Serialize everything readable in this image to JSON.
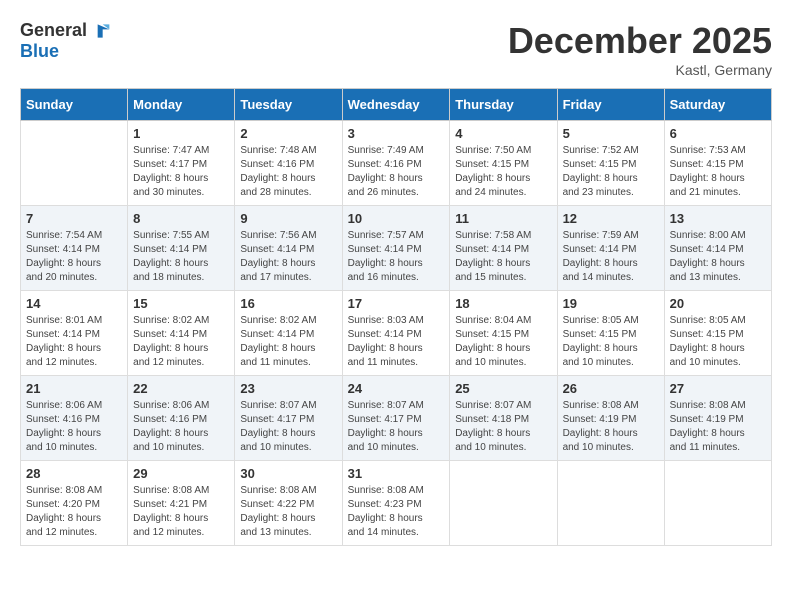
{
  "header": {
    "logo_general": "General",
    "logo_blue": "Blue",
    "month_year": "December 2025",
    "location": "Kastl, Germany"
  },
  "calendar": {
    "days_of_week": [
      "Sunday",
      "Monday",
      "Tuesday",
      "Wednesday",
      "Thursday",
      "Friday",
      "Saturday"
    ],
    "weeks": [
      [
        {
          "day": "",
          "sunrise": "",
          "sunset": "",
          "daylight": ""
        },
        {
          "day": "1",
          "sunrise": "Sunrise: 7:47 AM",
          "sunset": "Sunset: 4:17 PM",
          "daylight": "Daylight: 8 hours and 30 minutes."
        },
        {
          "day": "2",
          "sunrise": "Sunrise: 7:48 AM",
          "sunset": "Sunset: 4:16 PM",
          "daylight": "Daylight: 8 hours and 28 minutes."
        },
        {
          "day": "3",
          "sunrise": "Sunrise: 7:49 AM",
          "sunset": "Sunset: 4:16 PM",
          "daylight": "Daylight: 8 hours and 26 minutes."
        },
        {
          "day": "4",
          "sunrise": "Sunrise: 7:50 AM",
          "sunset": "Sunset: 4:15 PM",
          "daylight": "Daylight: 8 hours and 24 minutes."
        },
        {
          "day": "5",
          "sunrise": "Sunrise: 7:52 AM",
          "sunset": "Sunset: 4:15 PM",
          "daylight": "Daylight: 8 hours and 23 minutes."
        },
        {
          "day": "6",
          "sunrise": "Sunrise: 7:53 AM",
          "sunset": "Sunset: 4:15 PM",
          "daylight": "Daylight: 8 hours and 21 minutes."
        }
      ],
      [
        {
          "day": "7",
          "sunrise": "Sunrise: 7:54 AM",
          "sunset": "Sunset: 4:14 PM",
          "daylight": "Daylight: 8 hours and 20 minutes."
        },
        {
          "day": "8",
          "sunrise": "Sunrise: 7:55 AM",
          "sunset": "Sunset: 4:14 PM",
          "daylight": "Daylight: 8 hours and 18 minutes."
        },
        {
          "day": "9",
          "sunrise": "Sunrise: 7:56 AM",
          "sunset": "Sunset: 4:14 PM",
          "daylight": "Daylight: 8 hours and 17 minutes."
        },
        {
          "day": "10",
          "sunrise": "Sunrise: 7:57 AM",
          "sunset": "Sunset: 4:14 PM",
          "daylight": "Daylight: 8 hours and 16 minutes."
        },
        {
          "day": "11",
          "sunrise": "Sunrise: 7:58 AM",
          "sunset": "Sunset: 4:14 PM",
          "daylight": "Daylight: 8 hours and 15 minutes."
        },
        {
          "day": "12",
          "sunrise": "Sunrise: 7:59 AM",
          "sunset": "Sunset: 4:14 PM",
          "daylight": "Daylight: 8 hours and 14 minutes."
        },
        {
          "day": "13",
          "sunrise": "Sunrise: 8:00 AM",
          "sunset": "Sunset: 4:14 PM",
          "daylight": "Daylight: 8 hours and 13 minutes."
        }
      ],
      [
        {
          "day": "14",
          "sunrise": "Sunrise: 8:01 AM",
          "sunset": "Sunset: 4:14 PM",
          "daylight": "Daylight: 8 hours and 12 minutes."
        },
        {
          "day": "15",
          "sunrise": "Sunrise: 8:02 AM",
          "sunset": "Sunset: 4:14 PM",
          "daylight": "Daylight: 8 hours and 12 minutes."
        },
        {
          "day": "16",
          "sunrise": "Sunrise: 8:02 AM",
          "sunset": "Sunset: 4:14 PM",
          "daylight": "Daylight: 8 hours and 11 minutes."
        },
        {
          "day": "17",
          "sunrise": "Sunrise: 8:03 AM",
          "sunset": "Sunset: 4:14 PM",
          "daylight": "Daylight: 8 hours and 11 minutes."
        },
        {
          "day": "18",
          "sunrise": "Sunrise: 8:04 AM",
          "sunset": "Sunset: 4:15 PM",
          "daylight": "Daylight: 8 hours and 10 minutes."
        },
        {
          "day": "19",
          "sunrise": "Sunrise: 8:05 AM",
          "sunset": "Sunset: 4:15 PM",
          "daylight": "Daylight: 8 hours and 10 minutes."
        },
        {
          "day": "20",
          "sunrise": "Sunrise: 8:05 AM",
          "sunset": "Sunset: 4:15 PM",
          "daylight": "Daylight: 8 hours and 10 minutes."
        }
      ],
      [
        {
          "day": "21",
          "sunrise": "Sunrise: 8:06 AM",
          "sunset": "Sunset: 4:16 PM",
          "daylight": "Daylight: 8 hours and 10 minutes."
        },
        {
          "day": "22",
          "sunrise": "Sunrise: 8:06 AM",
          "sunset": "Sunset: 4:16 PM",
          "daylight": "Daylight: 8 hours and 10 minutes."
        },
        {
          "day": "23",
          "sunrise": "Sunrise: 8:07 AM",
          "sunset": "Sunset: 4:17 PM",
          "daylight": "Daylight: 8 hours and 10 minutes."
        },
        {
          "day": "24",
          "sunrise": "Sunrise: 8:07 AM",
          "sunset": "Sunset: 4:17 PM",
          "daylight": "Daylight: 8 hours and 10 minutes."
        },
        {
          "day": "25",
          "sunrise": "Sunrise: 8:07 AM",
          "sunset": "Sunset: 4:18 PM",
          "daylight": "Daylight: 8 hours and 10 minutes."
        },
        {
          "day": "26",
          "sunrise": "Sunrise: 8:08 AM",
          "sunset": "Sunset: 4:19 PM",
          "daylight": "Daylight: 8 hours and 10 minutes."
        },
        {
          "day": "27",
          "sunrise": "Sunrise: 8:08 AM",
          "sunset": "Sunset: 4:19 PM",
          "daylight": "Daylight: 8 hours and 11 minutes."
        }
      ],
      [
        {
          "day": "28",
          "sunrise": "Sunrise: 8:08 AM",
          "sunset": "Sunset: 4:20 PM",
          "daylight": "Daylight: 8 hours and 12 minutes."
        },
        {
          "day": "29",
          "sunrise": "Sunrise: 8:08 AM",
          "sunset": "Sunset: 4:21 PM",
          "daylight": "Daylight: 8 hours and 12 minutes."
        },
        {
          "day": "30",
          "sunrise": "Sunrise: 8:08 AM",
          "sunset": "Sunset: 4:22 PM",
          "daylight": "Daylight: 8 hours and 13 minutes."
        },
        {
          "day": "31",
          "sunrise": "Sunrise: 8:08 AM",
          "sunset": "Sunset: 4:23 PM",
          "daylight": "Daylight: 8 hours and 14 minutes."
        },
        {
          "day": "",
          "sunrise": "",
          "sunset": "",
          "daylight": ""
        },
        {
          "day": "",
          "sunrise": "",
          "sunset": "",
          "daylight": ""
        },
        {
          "day": "",
          "sunrise": "",
          "sunset": "",
          "daylight": ""
        }
      ]
    ]
  }
}
